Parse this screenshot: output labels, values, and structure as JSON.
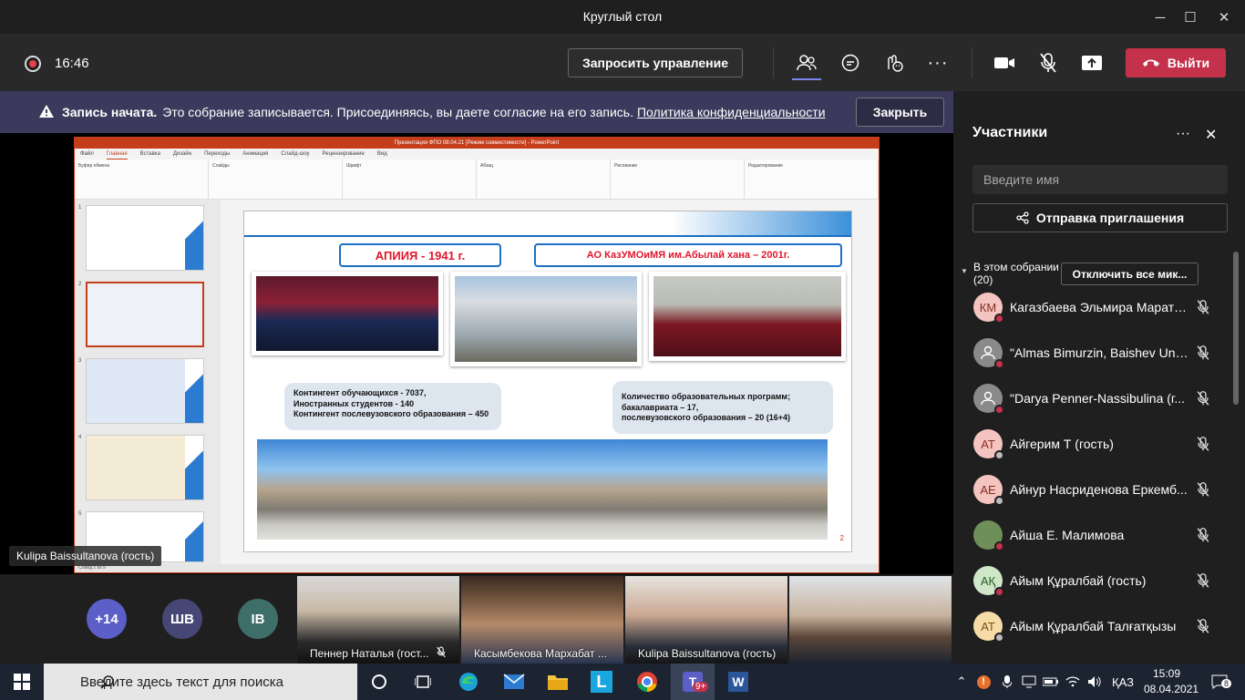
{
  "window": {
    "title": "Круглый стол",
    "minimize": "─",
    "maximize": "☐",
    "close": "✕"
  },
  "toolbar": {
    "time": "16:46",
    "request_control": "Запросить управление",
    "more": "···",
    "leave": "Выйти"
  },
  "banner": {
    "title": "Запись начата.",
    "text": "Это собрание записывается. Присоединяясь, вы даете согласие на его запись.",
    "link": "Политика конфиденциальности",
    "close": "Закрыть"
  },
  "ppt": {
    "title": "Презентация ФПО 08.04.21 [Режим совместимости] - PowerPoint",
    "tabs": [
      "Файл",
      "Главная",
      "Вставка",
      "Дизайн",
      "Переходы",
      "Анимация",
      "Слайд-шоу",
      "Рецензирование",
      "Вид"
    ],
    "ribbon": [
      "Буфер обмена",
      "Слайды",
      "Шрифт",
      "Абзац",
      "Рисование",
      "Редактирование"
    ],
    "thumb_numbers": [
      "1",
      "2",
      "3",
      "4",
      "5"
    ],
    "status": "Слайд 2 из 9"
  },
  "slide": {
    "header_left": "АПИИЯ -  1941 г.",
    "header_right": "АО КазУМОиМЯ им.Абылай хана – 2001г.",
    "info_left": [
      "Контингент обучающихся - 7037,",
      "Иностранных студентов - 140",
      "Контингент послевузовского образования – 450"
    ],
    "info_right": [
      "Количество образовательных программ;",
      "бакалавриата – 17,",
      "послевузовского образования – 20 (16+4)"
    ],
    "number": "2"
  },
  "presenter_label": "Kulipa Baissultanova (гость)",
  "gallery": {
    "overflow": "+14",
    "avatars": [
      "ШВ",
      "IB"
    ],
    "tiles": [
      "Пеннер Наталья (гост...",
      "Касымбекова Мархабат ...",
      "Kulipa Baissultanova (гость)"
    ]
  },
  "panel": {
    "title": "Участники",
    "search_placeholder": "Введите имя",
    "invite": "Отправка приглашения",
    "in_meeting": "В этом собрании",
    "count": "(20)",
    "mute_all": "Отключить все мик...",
    "participants": [
      {
        "initials": "КМ",
        "name": "Кагазбаева Эльмира Марато...",
        "color": "#f4c4c0",
        "text": "#8a2a22"
      },
      {
        "initials": "",
        "name": "\"Almas Bimurzin, Baishev Uni...",
        "color": "#8a8a8a",
        "text": "#fff"
      },
      {
        "initials": "",
        "name": "\"Darya Penner-Nassibulina (г...",
        "color": "#8a8a8a",
        "text": "#fff"
      },
      {
        "initials": "АТ",
        "name": "Айгерим Т (гость)",
        "color": "#f4c4c0",
        "text": "#8a2a22"
      },
      {
        "initials": "АЕ",
        "name": "Айнур Насриденова Еркемб...",
        "color": "#f4c4c0",
        "text": "#8a2a22"
      },
      {
        "initials": "",
        "name": "Айша Е. Малимова",
        "color": "#6f8f5a",
        "text": "#fff"
      },
      {
        "initials": "АҚ",
        "name": "Айым Құралбай (гость)",
        "color": "#cfe6c9",
        "text": "#2b5e25"
      },
      {
        "initials": "АТ",
        "name": "Айым Құралбай Талғатқызы",
        "color": "#f7dca8",
        "text": "#7a5210"
      }
    ]
  },
  "taskbar": {
    "search_placeholder": "Введите здесь текст для поиска",
    "lang": "ҚАЗ",
    "time": "15:09",
    "date": "08.04.2021",
    "notifications": "8",
    "teams_badge": "9+"
  }
}
